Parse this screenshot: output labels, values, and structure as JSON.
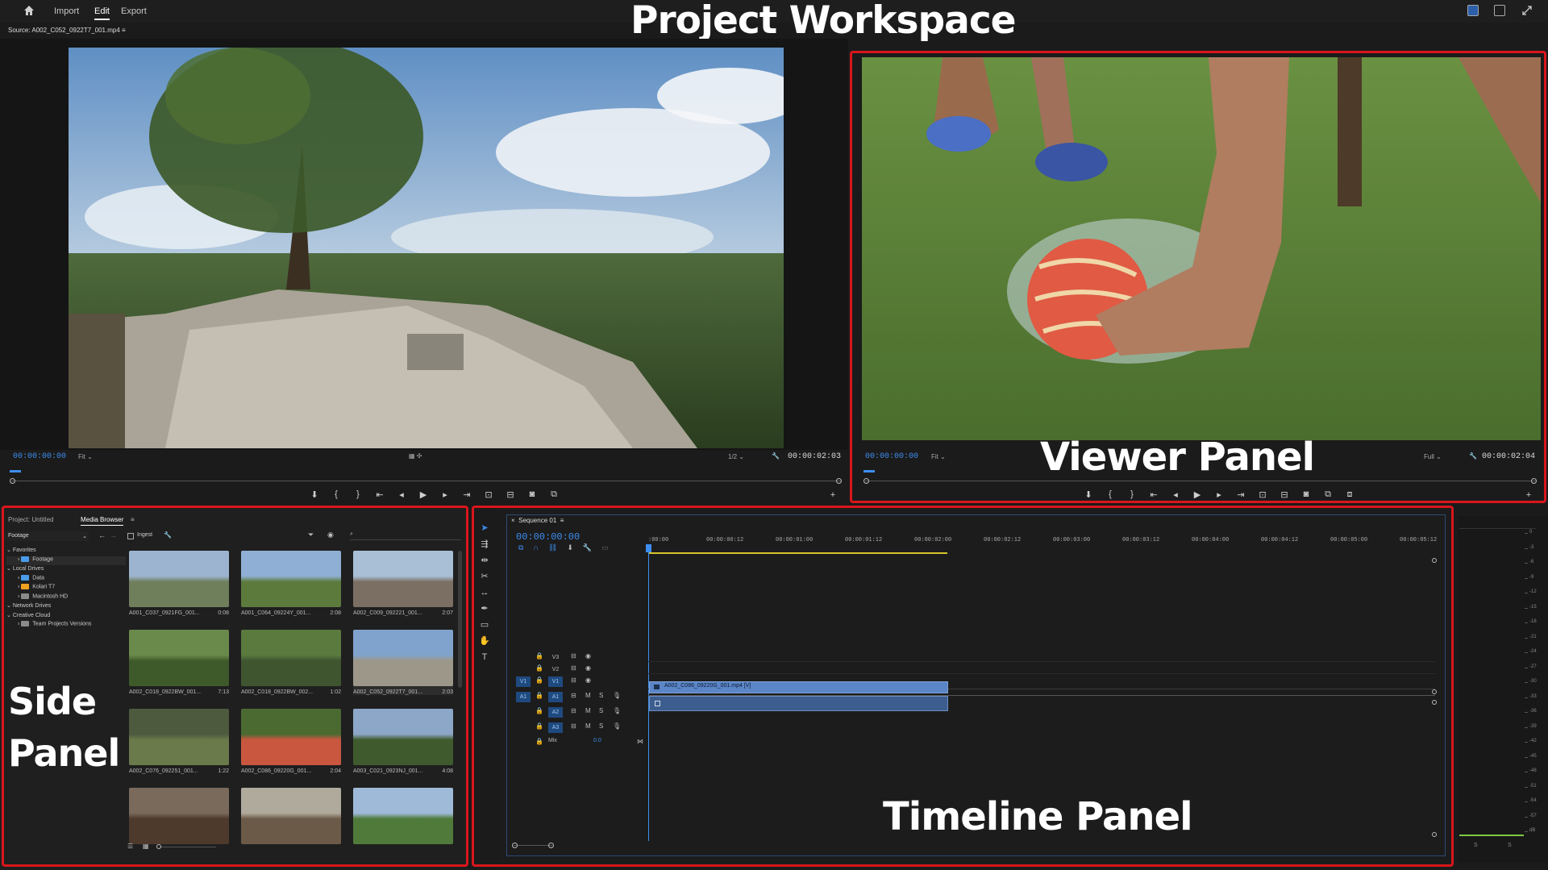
{
  "topbar": {
    "nav": [
      "Import",
      "Edit",
      "Export"
    ],
    "active": "Edit"
  },
  "headings": {
    "workspace": "Project Workspace",
    "viewer": "Viewer Panel",
    "side": [
      "Side",
      "Panel"
    ],
    "timeline": "Timeline Panel"
  },
  "source_monitor": {
    "tab": "Source: A002_C052_0922T7_001.mp4",
    "timecode": "00:00:00:00",
    "zoom": "Fit",
    "resolution": "1/2",
    "duration": "00:00:02:03"
  },
  "program_monitor": {
    "timecode": "00:00:00:00",
    "zoom": "Fit",
    "resolution": "Full",
    "duration": "00:00:02:04"
  },
  "side_panel": {
    "tabs": [
      "Project: Untitled",
      "Media Browser"
    ],
    "active_tab": "Media Browser",
    "location": "Footage",
    "ingest_label": "Ingest",
    "tree": [
      {
        "label": "Favorites",
        "level": 0,
        "type": "section"
      },
      {
        "label": "Footage",
        "level": 1,
        "type": "folder-blue"
      },
      {
        "label": "Local Drives",
        "level": 0,
        "type": "section"
      },
      {
        "label": "Data",
        "level": 1,
        "type": "folder-blue"
      },
      {
        "label": "Kolari T7",
        "level": 1,
        "type": "folder-orange"
      },
      {
        "label": "Macintosh HD",
        "level": 1,
        "type": "folder-gray"
      },
      {
        "label": "Network Drives",
        "level": 0,
        "type": "section"
      },
      {
        "label": "Creative Cloud",
        "level": 0,
        "type": "section"
      },
      {
        "label": "Team Projects Versions",
        "level": 1,
        "type": "folder-gray"
      }
    ],
    "thumbnails": [
      {
        "name": "A001_C037_0921FG_001...",
        "duration": "0:08"
      },
      {
        "name": "A001_C064_09224Y_001...",
        "duration": "2:08"
      },
      {
        "name": "A002_C009_092221_001...",
        "duration": "2:07"
      },
      {
        "name": "A002_C018_0922BW_001...",
        "duration": "7:13"
      },
      {
        "name": "A002_C018_0922BW_002...",
        "duration": "1:02"
      },
      {
        "name": "A002_C052_0922T7_001...",
        "duration": "2:03"
      },
      {
        "name": "A002_C076_092251_001...",
        "duration": "1:22"
      },
      {
        "name": "A002_C086_09220G_001...",
        "duration": "2:04"
      },
      {
        "name": "A003_C021_0923NJ_001...",
        "duration": "4:08"
      },
      {
        "name": "",
        "duration": ""
      },
      {
        "name": "",
        "duration": ""
      },
      {
        "name": "",
        "duration": ""
      }
    ]
  },
  "timeline": {
    "tab": "Sequence 01",
    "timecode": "00:00:00:00",
    "ruler": [
      ":00:00",
      "00:00:00:12",
      "00:00:01:00",
      "00:00:01:12",
      "00:00:02:00",
      "00:00:02:12",
      "00:00:03:00",
      "00:00:03:12",
      "00:00:04:00",
      "00:00:04:12",
      "00:00:05:00",
      "00:00:05:12"
    ],
    "video_tracks": [
      "V3",
      "V2",
      "V1"
    ],
    "audio_tracks": [
      "A1",
      "A2",
      "A3"
    ],
    "source_v": "V1",
    "source_a": "A1",
    "mix_label": "Mix",
    "mix_value": "0.0",
    "clip_name": "A002_C086_09220G_001.mp4 [V]",
    "track_buttons": [
      "M",
      "S"
    ]
  },
  "meter": {
    "scale": [
      "0",
      "-3",
      "-6",
      "-9",
      "-12",
      "-15",
      "-18",
      "-21",
      "-24",
      "-27",
      "-30",
      "-33",
      "-36",
      "-39",
      "-42",
      "-45",
      "-48",
      "-51",
      "-54",
      "-57",
      "dB"
    ],
    "solo": [
      "S",
      "S"
    ]
  },
  "colors": {
    "accent": "#3d8ef0",
    "highlight_box": "#d9161c",
    "clip": "#5b86c7"
  }
}
